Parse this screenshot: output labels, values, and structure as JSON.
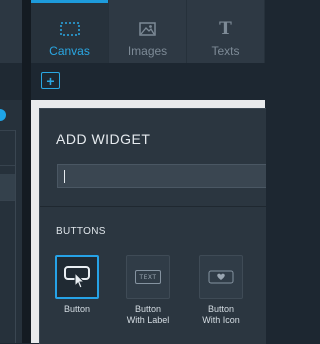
{
  "tabs": [
    {
      "label": "Canvas",
      "icon": "canvas-icon",
      "active": true
    },
    {
      "label": "Images",
      "icon": "image-icon",
      "active": false
    },
    {
      "label": "Texts",
      "icon": "text-icon",
      "glyph": "T",
      "active": false
    }
  ],
  "toolbar": {
    "add_glyph": "+"
  },
  "panel": {
    "title": "ADD WIDGET",
    "search_value": "",
    "section_title": "BUTTONS",
    "widgets": [
      {
        "label_lines": [
          "Button"
        ],
        "icon": "button-cursor-icon",
        "selected": true
      },
      {
        "label_lines": [
          "Button",
          "With Label"
        ],
        "icon": "text-button-icon",
        "icon_text": "TEXT",
        "selected": false
      },
      {
        "label_lines": [
          "Button",
          "With Icon"
        ],
        "icon": "heart-button-icon",
        "selected": false
      }
    ]
  },
  "colors": {
    "accent": "#26a2e6",
    "panel_bg": "#2b3640",
    "canvas_bg": "#e8eaec"
  }
}
